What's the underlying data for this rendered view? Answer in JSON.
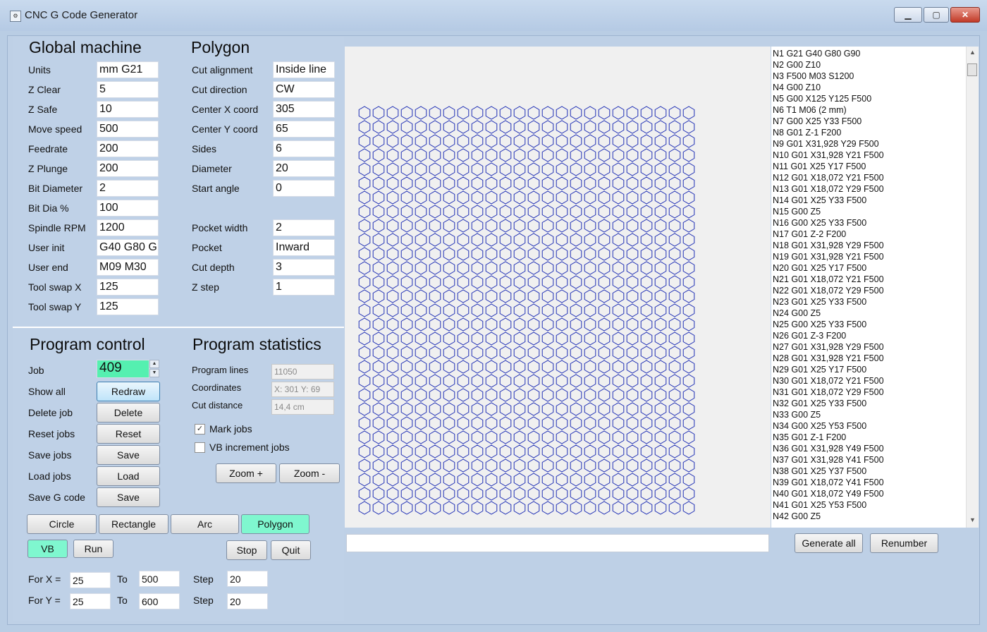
{
  "window": {
    "title": "CNC G Code Generator",
    "minimize": "▁",
    "maximize": "▢",
    "close": "✕",
    "icon": "app-icon"
  },
  "global": {
    "heading": "Global machine",
    "fields": [
      {
        "label": "Units",
        "value": "mm G21"
      },
      {
        "label": "Z Clear",
        "value": "5"
      },
      {
        "label": "Z Safe",
        "value": "10"
      },
      {
        "label": "Move speed",
        "value": "500"
      },
      {
        "label": "Feedrate",
        "value": "200"
      },
      {
        "label": "Z Plunge",
        "value": "200"
      },
      {
        "label": "Bit Diameter",
        "value": "2"
      },
      {
        "label": "Bit Dia %",
        "value": "100"
      },
      {
        "label": "Spindle RPM",
        "value": "1200"
      },
      {
        "label": "User init",
        "value": "G40 G80 G"
      },
      {
        "label": "User end",
        "value": "M09 M30"
      },
      {
        "label": "Tool swap X",
        "value": "125"
      },
      {
        "label": "Tool swap Y",
        "value": "125"
      }
    ]
  },
  "polygon": {
    "heading": "Polygon",
    "fields": [
      {
        "label": "Cut alignment",
        "value": "Inside line"
      },
      {
        "label": "Cut direction",
        "value": "CW"
      },
      {
        "label": "Center X coord",
        "value": "305"
      },
      {
        "label": "Center Y coord",
        "value": "65"
      },
      {
        "label": "Sides",
        "value": "6"
      },
      {
        "label": "Diameter",
        "value": "20"
      },
      {
        "label": "Start angle",
        "value": "0"
      }
    ],
    "fields2": [
      {
        "label": "Pocket width",
        "value": "2"
      },
      {
        "label": "Pocket",
        "value": "Inward"
      },
      {
        "label": "Cut depth",
        "value": "3"
      },
      {
        "label": "Z step",
        "value": "1"
      }
    ]
  },
  "program_control": {
    "heading": "Program control",
    "job_label": "Job",
    "job_value": "409",
    "rows": [
      {
        "label": "Show all",
        "button": "Redraw"
      },
      {
        "label": "Delete job",
        "button": "Delete"
      },
      {
        "label": "Reset jobs",
        "button": "Reset"
      },
      {
        "label": "Save jobs",
        "button": "Save"
      },
      {
        "label": "Load jobs",
        "button": "Load"
      },
      {
        "label": "Save G code",
        "button": "Save"
      }
    ]
  },
  "stats": {
    "heading": "Program statistics",
    "rows": [
      {
        "label": "Program lines",
        "value": "11050"
      },
      {
        "label": "Coordinates",
        "value": "X: 301  Y: 69"
      },
      {
        "label": "Cut distance",
        "value": "14,4 cm"
      }
    ],
    "mark_jobs": "Mark jobs",
    "mark_jobs_checked": true,
    "vb_increment": "VB increment jobs",
    "vb_increment_checked": false,
    "zoom_in": "Zoom +",
    "zoom_out": "Zoom -"
  },
  "shape_tabs": [
    "Circle",
    "Rectangle",
    "Arc",
    "Polygon"
  ],
  "active_shape": "Polygon",
  "vb": {
    "vb_button": "VB",
    "run_button": "Run",
    "stop_button": "Stop",
    "quit_button": "Quit"
  },
  "loop": {
    "for_x": "For X =",
    "for_y": "For Y =",
    "to": "To",
    "step": "Step",
    "x_from": "25",
    "x_to": "500",
    "x_step": "20",
    "y_from": "25",
    "y_to": "600",
    "y_step": "20"
  },
  "canvas": {
    "shape": "hexagon",
    "columns": 24,
    "rows": 29,
    "stroke": "#1f2fb5"
  },
  "gcode": [
    "N1 G21 G40 G80 G90",
    "N2 G00 Z10",
    "N3  F500 M03 S1200",
    "N4 G00 Z10",
    "N5 G00 X125 Y125 F500",
    "N6 T1 M06 (2 mm)",
    "N7 G00 X25 Y33 F500",
    "N8 G01 Z-1 F200",
    "N9 G01 X31,928 Y29 F500",
    "N10 G01 X31,928 Y21 F500",
    "N11 G01 X25 Y17 F500",
    "N12 G01 X18,072 Y21 F500",
    "N13 G01 X18,072 Y29 F500",
    "N14 G01 X25 Y33 F500",
    "N15 G00 Z5",
    "N16 G00 X25 Y33 F500",
    "N17 G01 Z-2 F200",
    "N18 G01 X31,928 Y29 F500",
    "N19 G01 X31,928 Y21 F500",
    "N20 G01 X25 Y17 F500",
    "N21 G01 X18,072 Y21 F500",
    "N22 G01 X18,072 Y29 F500",
    "N23 G01 X25 Y33 F500",
    "N24 G00 Z5",
    "N25 G00 X25 Y33 F500",
    "N26 G01 Z-3 F200",
    "N27 G01 X31,928 Y29 F500",
    "N28 G01 X31,928 Y21 F500",
    "N29 G01 X25 Y17 F500",
    "N30 G01 X18,072 Y21 F500",
    "N31 G01 X18,072 Y29 F500",
    "N32 G01 X25 Y33 F500",
    "N33 G00 Z5",
    "N34 G00 X25 Y53 F500",
    "N35 G01 Z-1 F200",
    "N36 G01 X31,928 Y49 F500",
    "N37 G01 X31,928 Y41 F500",
    "N38 G01 X25 Y37 F500",
    "N39 G01 X18,072 Y41 F500",
    "N40 G01 X18,072 Y49 F500",
    "N41 G01 X25 Y53 F500",
    "N42 G00 Z5"
  ],
  "status_text": "",
  "generate_all": "Generate all",
  "renumber": "Renumber"
}
